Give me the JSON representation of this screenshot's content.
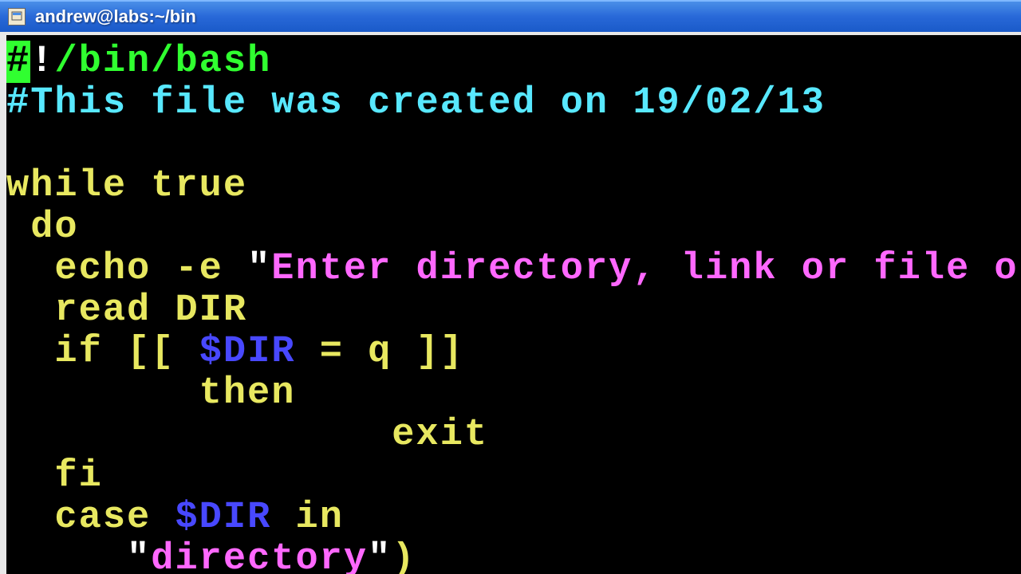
{
  "titlebar": {
    "title": "andrew@labs:~/bin"
  },
  "code": {
    "line1": {
      "cursor_char": "#",
      "shebang_bang": "!",
      "shebang_path": "/bin/bash"
    },
    "line2": {
      "hash": "#",
      "comment": "This file was created on 19/02/13"
    },
    "line3": {
      "blank": " "
    },
    "line4": {
      "kw_while": "while",
      "kw_true": " true"
    },
    "line5": {
      "indent": " ",
      "kw_do": "do"
    },
    "line6": {
      "indent": "  ",
      "echo": "echo",
      "flag": " -e ",
      "quote": "\"",
      "str": "Enter directory, link or file or q t"
    },
    "line7": {
      "indent": "  ",
      "read": "read",
      "var": " DIR"
    },
    "line8": {
      "indent": "  ",
      "if": "if",
      "sp": " ",
      "lbr": "[[",
      "sp2": " ",
      "var": "$DIR",
      "eq": " = q ",
      "rbr": "]]"
    },
    "line9": {
      "indent": "        ",
      "then": "then"
    },
    "line10": {
      "indent": "                ",
      "exit": "exit"
    },
    "line11": {
      "indent": "  ",
      "fi": "fi"
    },
    "line12": {
      "indent": "  ",
      "case": "case",
      "sp": " ",
      "var": "$DIR",
      "in": " in"
    },
    "line13": {
      "indent": "     ",
      "quote": "\"",
      "str": "directory",
      "quote2": "\"",
      "paren": ")"
    }
  }
}
